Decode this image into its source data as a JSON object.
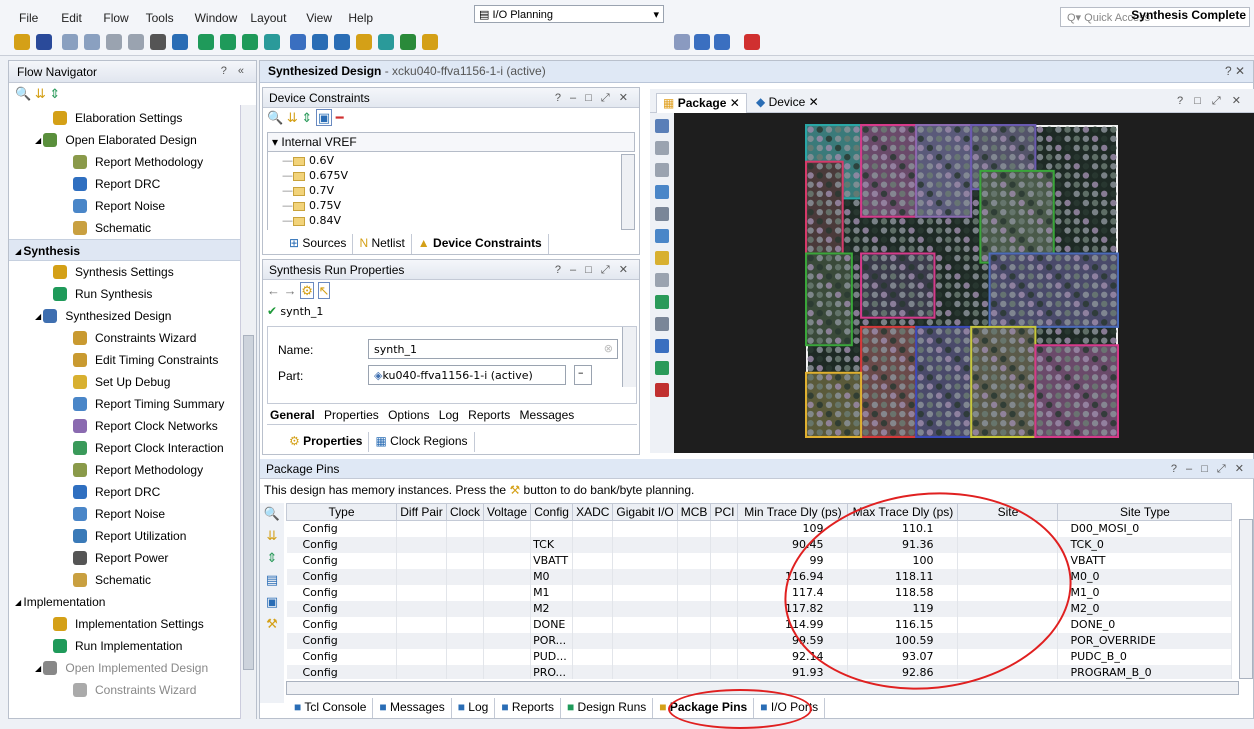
{
  "menu": [
    "File",
    "Edit",
    "Flow",
    "Tools",
    "Window",
    "Layout",
    "View",
    "Help"
  ],
  "quick_access_placeholder": "Quick Access",
  "toolbar": {
    "layout_value": "I/O Planning",
    "status": "Synthesis Complete"
  },
  "flow_navigator": {
    "title": "Flow Navigator",
    "items": [
      {
        "label": "Elaboration Settings",
        "icon": "gear-icon",
        "indent": 2,
        "color": "#d4a017"
      },
      {
        "label": "Open Elaborated Design",
        "icon": "open-design-icon",
        "indent": 1,
        "color": "#5a8f3c",
        "expander": "◢"
      },
      {
        "label": "Report Methodology",
        "icon": "report-icon",
        "indent": 3,
        "color": "#8a9a4a"
      },
      {
        "label": "Report DRC",
        "icon": "check-icon",
        "indent": 3,
        "color": "#2f6fc0"
      },
      {
        "label": "Report Noise",
        "icon": "noise-icon",
        "indent": 3,
        "color": "#4a86c8"
      },
      {
        "label": "Schematic",
        "icon": "schematic-icon",
        "indent": 3,
        "color": "#c9a040"
      },
      {
        "label": "Synthesis",
        "section": true,
        "expander": "◢"
      },
      {
        "label": "Synthesis Settings",
        "icon": "gear-icon",
        "indent": 2,
        "color": "#d4a017"
      },
      {
        "label": "Run Synthesis",
        "icon": "run-icon",
        "indent": 2,
        "color": "#1f9a5a"
      },
      {
        "label": "Synthesized Design",
        "icon": "design-icon",
        "indent": 1,
        "color": "#3f6fb0",
        "expander": "◢"
      },
      {
        "label": "Constraints Wizard",
        "icon": "wizard-icon",
        "indent": 3,
        "color": "#c99a30"
      },
      {
        "label": "Edit Timing Constraints",
        "icon": "timing-icon",
        "indent": 3,
        "color": "#c99a30"
      },
      {
        "label": "Set Up Debug",
        "icon": "debug-icon",
        "indent": 3,
        "color": "#d8b030"
      },
      {
        "label": "Report Timing Summary",
        "icon": "timing-summary-icon",
        "indent": 3,
        "color": "#4a86c8"
      },
      {
        "label": "Report Clock Networks",
        "icon": "clock-networks-icon",
        "indent": 3,
        "color": "#8a6ab0"
      },
      {
        "label": "Report Clock Interaction",
        "icon": "clock-interaction-icon",
        "indent": 3,
        "color": "#3a9a5a"
      },
      {
        "label": "Report Methodology",
        "icon": "report-icon",
        "indent": 3,
        "color": "#8a9a4a"
      },
      {
        "label": "Report DRC",
        "icon": "check-icon",
        "indent": 3,
        "color": "#2f6fc0"
      },
      {
        "label": "Report Noise",
        "icon": "noise-icon",
        "indent": 3,
        "color": "#4a86c8"
      },
      {
        "label": "Report Utilization",
        "icon": "utilization-icon",
        "indent": 3,
        "color": "#3a7ab8"
      },
      {
        "label": "Report Power",
        "icon": "power-icon",
        "indent": 3,
        "color": "#555"
      },
      {
        "label": "Schematic",
        "icon": "schematic-icon",
        "indent": 3,
        "color": "#c9a040"
      },
      {
        "label": "Implementation",
        "section2": true,
        "expander": "◢"
      },
      {
        "label": "Implementation Settings",
        "icon": "gear-icon",
        "indent": 2,
        "color": "#d4a017"
      },
      {
        "label": "Run Implementation",
        "icon": "run-icon",
        "indent": 2,
        "color": "#1f9a5a"
      },
      {
        "label": "Open Implemented Design",
        "icon": "open-design-icon",
        "indent": 1,
        "color": "#888",
        "expander": "◢",
        "dim": true
      },
      {
        "label": "Constraints Wizard",
        "icon": "wizard-icon",
        "indent": 3,
        "color": "#aaa",
        "dim": true
      }
    ]
  },
  "main": {
    "title": "Synthesized Design",
    "subtitle": " - xcku040-ffva1156-1-i",
    "status": "(active)",
    "device_constraints": {
      "title": "Device Constraints",
      "root": "Internal VREF",
      "items": [
        "0.6V",
        "0.675V",
        "0.7V",
        "0.75V",
        "0.84V"
      ],
      "tabs": [
        "Sources",
        "Netlist",
        "Device Constraints"
      ]
    },
    "run_props": {
      "title": "Synthesis Run Properties",
      "run_name": "synth_1",
      "name_label": "Name:",
      "name_value": "synth_1",
      "part_label": "Part:",
      "part_value": "ku040-ffva1156-1-i (active)",
      "tabs": [
        "General",
        "Properties",
        "Options",
        "Log",
        "Reports",
        "Messages"
      ],
      "bottom_tabs": [
        "Properties",
        "Clock Regions"
      ]
    },
    "package_tabs": [
      "Package",
      "Device"
    ],
    "package_pins": {
      "title": "Package Pins",
      "notice_before": "This design has memory instances. Press the",
      "notice_after": "button to do bank/byte planning.",
      "columns": [
        "Type",
        "Diff Pair",
        "Clock",
        "Voltage",
        "Config",
        "XADC",
        "Gigabit I/O",
        "MCB",
        "PCI",
        "Min Trace Dly (ps)",
        "Max Trace Dly (ps)",
        "Site",
        "Site Type"
      ],
      "rows": [
        {
          "type": "Config",
          "config": "",
          "min": "109",
          "max": "110.1",
          "site_type": "D00_MOSI_0"
        },
        {
          "type": "Config",
          "config": "TCK",
          "min": "90.45",
          "max": "91.36",
          "site_type": "TCK_0"
        },
        {
          "type": "Config",
          "config": "VBATT",
          "min": "99",
          "max": "100",
          "site_type": "VBATT"
        },
        {
          "type": "Config",
          "config": "M0",
          "min": "116.94",
          "max": "118.11",
          "site_type": "M0_0"
        },
        {
          "type": "Config",
          "config": "M1",
          "min": "117.4",
          "max": "118.58",
          "site_type": "M1_0"
        },
        {
          "type": "Config",
          "config": "M2",
          "min": "117.82",
          "max": "119",
          "site_type": "M2_0"
        },
        {
          "type": "Config",
          "config": "DONE",
          "min": "114.99",
          "max": "116.15",
          "site_type": "DONE_0"
        },
        {
          "type": "Config",
          "config": "POR...",
          "min": "99.59",
          "max": "100.59",
          "site_type": "POR_OVERRIDE"
        },
        {
          "type": "Config",
          "config": "PUD...",
          "min": "92.14",
          "max": "93.07",
          "site_type": "PUDC_B_0"
        },
        {
          "type": "Config",
          "config": "PRO...",
          "min": "91.93",
          "max": "92.86",
          "site_type": "PROGRAM_B_0"
        }
      ]
    },
    "bottom_tabs": [
      "Tcl Console",
      "Messages",
      "Log",
      "Reports",
      "Design Runs",
      "Package Pins",
      "I/O Ports"
    ]
  }
}
